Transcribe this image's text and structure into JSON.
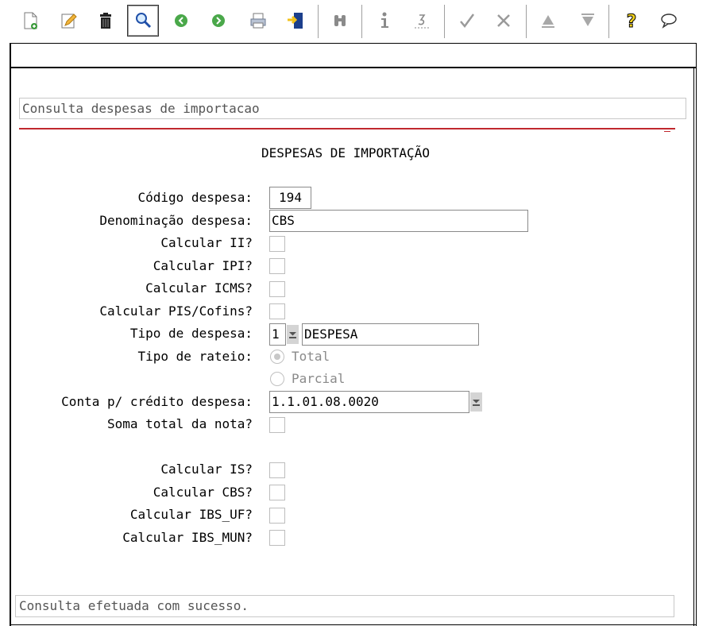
{
  "toolbar": {
    "buttons": [
      {
        "name": "new-icon"
      },
      {
        "name": "edit-icon"
      },
      {
        "name": "delete-icon"
      },
      {
        "name": "search-icon"
      },
      {
        "name": "previous-icon"
      },
      {
        "name": "next-icon"
      },
      {
        "name": "print-icon"
      },
      {
        "name": "exit-icon"
      },
      {
        "name": "binoculars-icon"
      },
      {
        "name": "info-icon"
      },
      {
        "name": "sort-icon"
      },
      {
        "name": "confirm-icon"
      },
      {
        "name": "cancel-icon"
      },
      {
        "name": "up-icon"
      },
      {
        "name": "down-icon"
      },
      {
        "name": "help-icon"
      },
      {
        "name": "comment-icon"
      }
    ]
  },
  "program": {
    "title": "Consulta despesas de importacao"
  },
  "form": {
    "heading": "DESPESAS DE IMPORTAÇÃO",
    "codigo": {
      "label": "Código despesa:",
      "value": "194"
    },
    "denominacao": {
      "label": "Denominação despesa:",
      "value": "CBS"
    },
    "calcular_ii": {
      "label": "Calcular II?",
      "checked": false
    },
    "calcular_ipi": {
      "label": "Calcular IPI?",
      "checked": false
    },
    "calcular_icms": {
      "label": "Calcular ICMS?",
      "checked": false
    },
    "calcular_pis_cofins": {
      "label": "Calcular PIS/Cofins?",
      "checked": false
    },
    "tipo_despesa": {
      "label": "Tipo de despesa:",
      "code": "1",
      "description": "DESPESA"
    },
    "tipo_rateio": {
      "label": "Tipo de rateio:",
      "options": [
        {
          "label": "Total",
          "selected": true
        },
        {
          "label": "Parcial",
          "selected": false
        }
      ]
    },
    "conta_credito": {
      "label": "Conta p/ crédito despesa:",
      "value": "1.1.01.08.0020"
    },
    "soma_total": {
      "label": "Soma total da nota?",
      "checked": false
    },
    "calcular_is": {
      "label": "Calcular IS?",
      "checked": false
    },
    "calcular_cbs": {
      "label": "Calcular CBS?",
      "checked": false
    },
    "calcular_ibs_uf": {
      "label": "Calcular IBS_UF?",
      "checked": false
    },
    "calcular_ibs_mun": {
      "label": "Calcular IBS_MUN?",
      "checked": false
    }
  },
  "status": {
    "message": "Consulta efetuada com sucesso."
  },
  "colors": {
    "accent_red": "#c0282e",
    "disabled_text": "#8a8a8a"
  }
}
